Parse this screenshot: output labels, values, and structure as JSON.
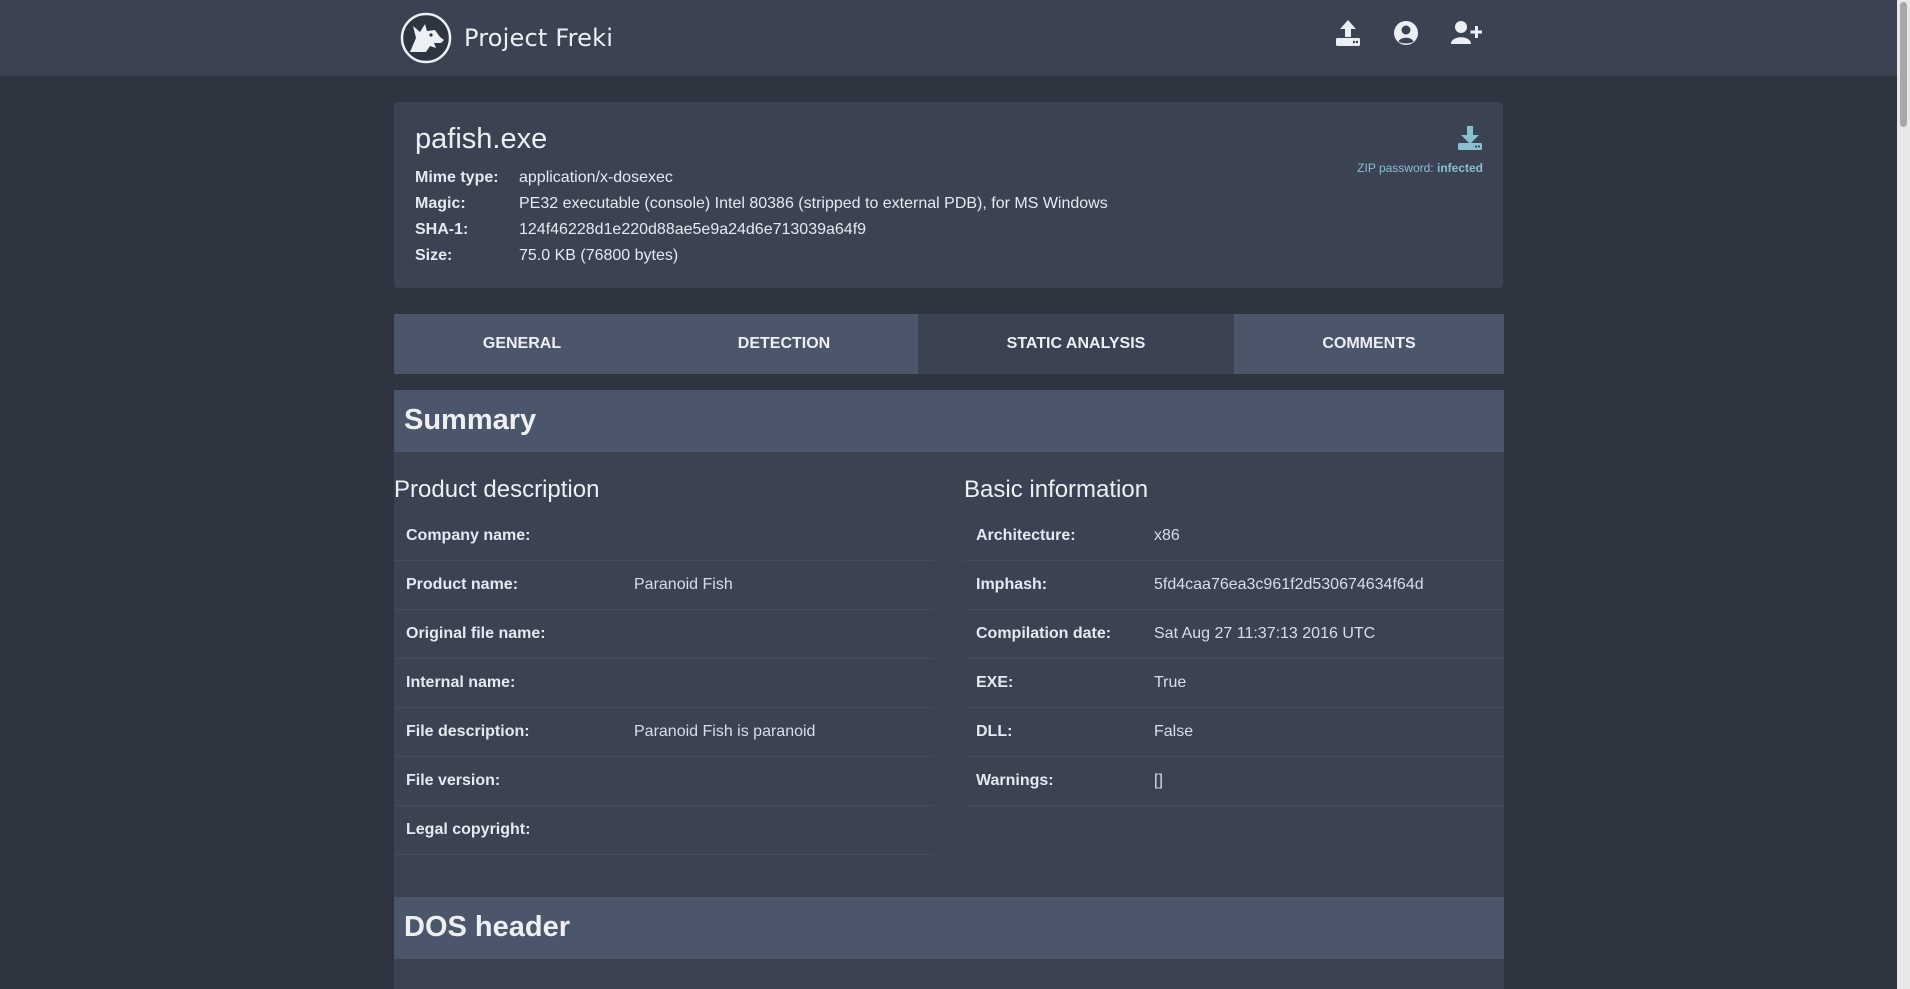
{
  "app": {
    "title": "Project Freki"
  },
  "nav": {
    "icons": [
      "upload-icon",
      "user-circle-icon",
      "user-plus-icon"
    ]
  },
  "file": {
    "name": "pafish.exe",
    "meta": [
      {
        "key": "Mime type:",
        "value": "application/x-dosexec"
      },
      {
        "key": "Magic:",
        "value": "PE32 executable (console) Intel 80386 (stripped to external PDB), for MS Windows"
      },
      {
        "key": "SHA-1:",
        "value": "124f46228d1e220d88ae5e9a24d6e713039a64f9"
      },
      {
        "key": "Size:",
        "value": "75.0 KB (76800 bytes)"
      }
    ],
    "zip_label": "ZIP password:",
    "zip_password": "infected"
  },
  "tabs": [
    {
      "label": "GENERAL",
      "active": false
    },
    {
      "label": "DETECTION",
      "active": false
    },
    {
      "label": "STATIC ANALYSIS",
      "active": true
    },
    {
      "label": "COMMENTS",
      "active": false
    }
  ],
  "summary": {
    "title": "Summary",
    "product": {
      "title": "Product description",
      "rows": [
        {
          "key": "Company name:",
          "value": ""
        },
        {
          "key": "Product name:",
          "value": "Paranoid Fish"
        },
        {
          "key": "Original file name:",
          "value": ""
        },
        {
          "key": "Internal name:",
          "value": ""
        },
        {
          "key": "File description:",
          "value": "Paranoid Fish is paranoid"
        },
        {
          "key": "File version:",
          "value": ""
        },
        {
          "key": "Legal copyright:",
          "value": ""
        }
      ]
    },
    "basic": {
      "title": "Basic information",
      "rows": [
        {
          "key": "Architecture:",
          "value": "x86"
        },
        {
          "key": "Imphash:",
          "value": "5fd4caa76ea3c961f2d530674634f64d"
        },
        {
          "key": "Compilation date:",
          "value": "Sat Aug 27 11:37:13 2016 UTC"
        },
        {
          "key": "EXE:",
          "value": "True"
        },
        {
          "key": "DLL:",
          "value": "False"
        },
        {
          "key": "Warnings:",
          "value": "[]"
        }
      ]
    }
  },
  "dos_header": {
    "title": "DOS header"
  },
  "colors": {
    "background": "#2e3440",
    "card": "#3b4252",
    "header": "#4c566a",
    "accent": "#88c0d0"
  }
}
